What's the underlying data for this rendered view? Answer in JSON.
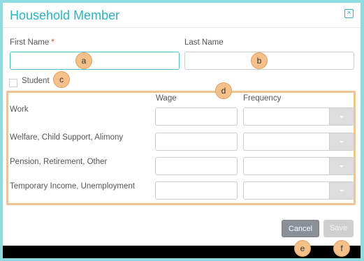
{
  "dialog": {
    "title": "Household Member",
    "close_icon": "close-icon"
  },
  "form": {
    "first_name_label": "First Name",
    "required_marker": "*",
    "last_name_label": "Last Name",
    "first_name_value": "",
    "last_name_value": "",
    "student_label": "Student",
    "student_checked": false
  },
  "income": {
    "wage_header": "Wage",
    "frequency_header": "Frequency",
    "rows": [
      {
        "label": "Work",
        "wage": "",
        "frequency": ""
      },
      {
        "label": "Welfare, Child Support, Alimony",
        "wage": "",
        "frequency": ""
      },
      {
        "label": "Pension, Retirement, Other",
        "wage": "",
        "frequency": ""
      },
      {
        "label": "Temporary Income, Unemployment",
        "wage": "",
        "frequency": ""
      }
    ]
  },
  "footer": {
    "cancel_label": "Cancel",
    "save_label": "Save"
  },
  "annotations": {
    "a": "a",
    "b": "b",
    "c": "c",
    "d": "d",
    "e": "e",
    "f": "f"
  },
  "colors": {
    "accent": "#2bb3bf",
    "background": "#8fdce0",
    "highlight": "#f2c38f",
    "badge": "#f5c08a"
  }
}
